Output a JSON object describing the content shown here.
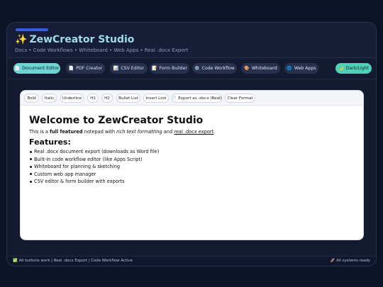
{
  "header": {
    "title_icon": "✨",
    "title": "ZewCreator Studio",
    "subtitle": "Docs • Code Workflows • Whiteboard • Web Apps • Real .docx Export"
  },
  "nav": {
    "items": [
      {
        "icon": "📄",
        "label": "Document Editor",
        "active": true
      },
      {
        "icon": "📄",
        "label": "PDF Creator"
      },
      {
        "icon": "📊",
        "label": "CSV Editor"
      },
      {
        "icon": "📝",
        "label": "Form Builder"
      },
      {
        "icon": "⚙️",
        "label": "Code Workflow"
      },
      {
        "icon": "🎨",
        "label": "Whiteboard"
      },
      {
        "icon": "🌐",
        "label": "Web Apps"
      }
    ],
    "theme_toggle": {
      "icon": "🌙",
      "label": "Dark/Light"
    }
  },
  "toolbar": {
    "bold": "Bold",
    "italic": "Italic",
    "underline": "Underline",
    "h1": "H1",
    "h2": "H2",
    "bullet": "Bullet List",
    "link": "Insert Link",
    "export_icon": "📄",
    "export": "Export as .docx (Real)",
    "clear": "Clear Format"
  },
  "document": {
    "heading": "Welcome to ZewCreator Studio",
    "intro_a": "This is a ",
    "intro_b": "full featured",
    "intro_c": " notepad with ",
    "intro_d": "rich text formatting",
    "intro_e": " and ",
    "intro_f": "real .docx export",
    "intro_g": ".",
    "features_heading": "Features:",
    "features": [
      "Real .docx document export (downloads as Word file)",
      "Built-in code workflow editor (like Apps Script)",
      "Whiteboard for planning & sketching",
      "Custom web app manager",
      "CSV editor & form builder with exports"
    ]
  },
  "footer": {
    "left_icon": "✅",
    "left": "All buttons work | Real .docx Export | Code Workflow Active",
    "right_icon": "🚀",
    "right": "All systems ready"
  },
  "colors": {
    "background": "#0d1326",
    "accent_active": "#6ed4d4",
    "accent_theme": "#4fd0b8",
    "nav_button": "#27304d"
  }
}
